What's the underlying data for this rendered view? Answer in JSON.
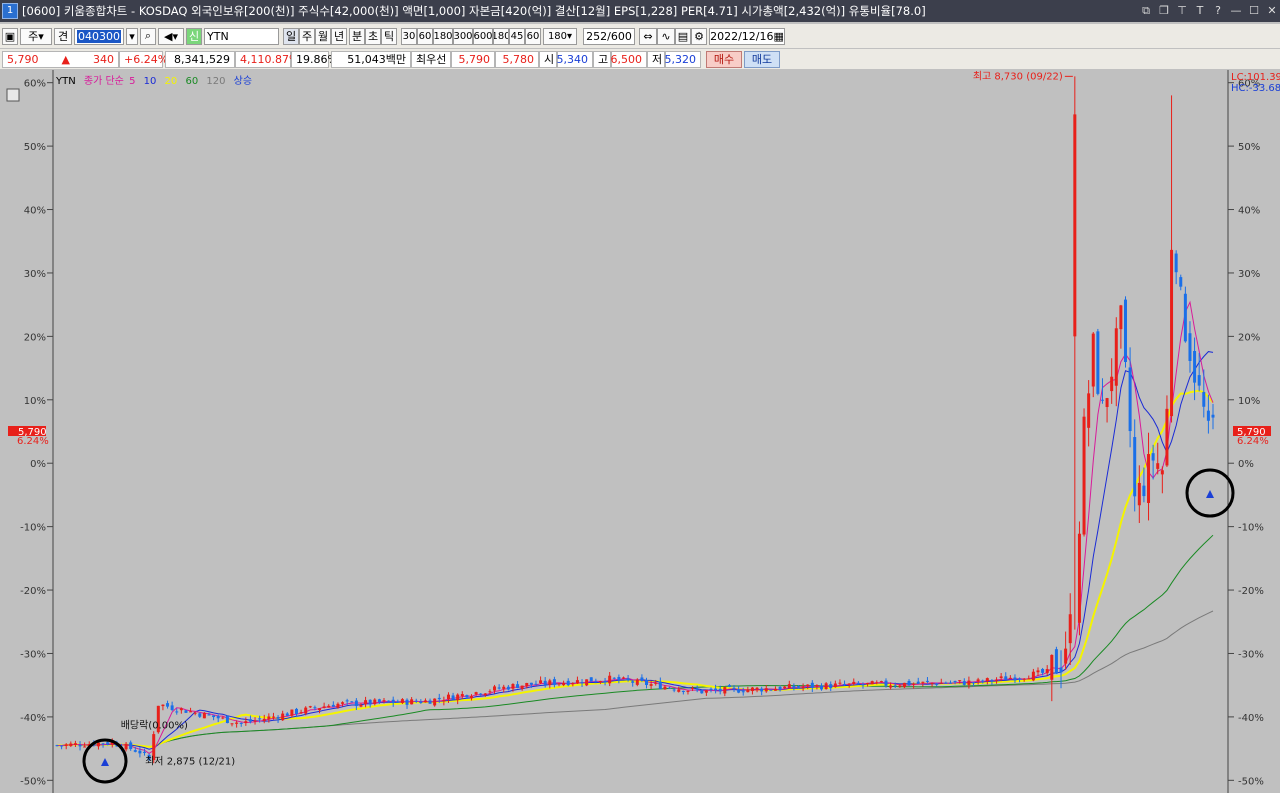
{
  "window": {
    "title": "[0600] 키움종합차트 - KOSDAQ 외국인보유[200(천)] 주식수[42,000(천)] 액면[1,000] 자본금[420(억)] 결산[12월] EPS[1,228] PER[4.71] 시가총액[2,432(억)] 유통비율[78.0]",
    "icon_label": "1"
  },
  "toolbar": {
    "mode1": "주",
    "mode2": "견",
    "code": "040300",
    "search_icon": "magnifier-icon",
    "sound_icon": "speaker-icon",
    "new_badge": "신",
    "name": "YTN",
    "periods": [
      "일",
      "주",
      "월",
      "년",
      "분",
      "초",
      "틱"
    ],
    "active_period": "일",
    "minute_options": [
      "30",
      "60",
      "180",
      "300",
      "600",
      "180"
    ],
    "tick_options": [
      "45",
      "60"
    ],
    "selected_minutes": "180",
    "count": "252",
    "count_total": "/600",
    "date": "2022/12/16"
  },
  "infobar": {
    "price": "5,790",
    "arrow": "▲",
    "change": "340",
    "change_pct": "+6.24%",
    "volume": "8,341,529",
    "volume_pct": "4,110.87%",
    "turnover": "19.86%",
    "amount": "51,043백만",
    "best_label": "최우선",
    "best_ask": "5,790",
    "best_bid": "5,780",
    "open_label": "시",
    "open": "5,340",
    "high_label": "고",
    "high": "6,500",
    "low_label": "저",
    "low": "5,320",
    "buy_label": "매수",
    "sell_label": "매도"
  },
  "legend": {
    "name": "YTN",
    "ma_label": "종가 단순",
    "ma": [
      "5",
      "10",
      "20",
      "60",
      "120"
    ],
    "status": "상승"
  },
  "chart_data": {
    "type": "candlestick",
    "y_axis_unit": "%",
    "ylim": [
      -52,
      62
    ],
    "y_ticks": [
      60,
      50,
      40,
      30,
      20,
      10,
      0,
      -10,
      -20,
      -30,
      -40,
      -50
    ],
    "lc_label": "LC:101.39",
    "hc_label": "HC:-33.68",
    "last_price": "5,790",
    "last_pct": "6.24%",
    "high_annotation": "최고 8,730 (09/22)",
    "low_annotation": "최저 2,875 (12/21)",
    "dividend_annotation": "배당락(0.00%)",
    "ma_colors": {
      "ma5": "#d81b9a",
      "ma10": "#1a2bd6",
      "ma20": "#f4f400",
      "ma60": "#1a8a24",
      "ma120": "#7a7a7a"
    },
    "up_color": "#e8201a",
    "down_color": "#1a6fe8",
    "candles": []
  }
}
